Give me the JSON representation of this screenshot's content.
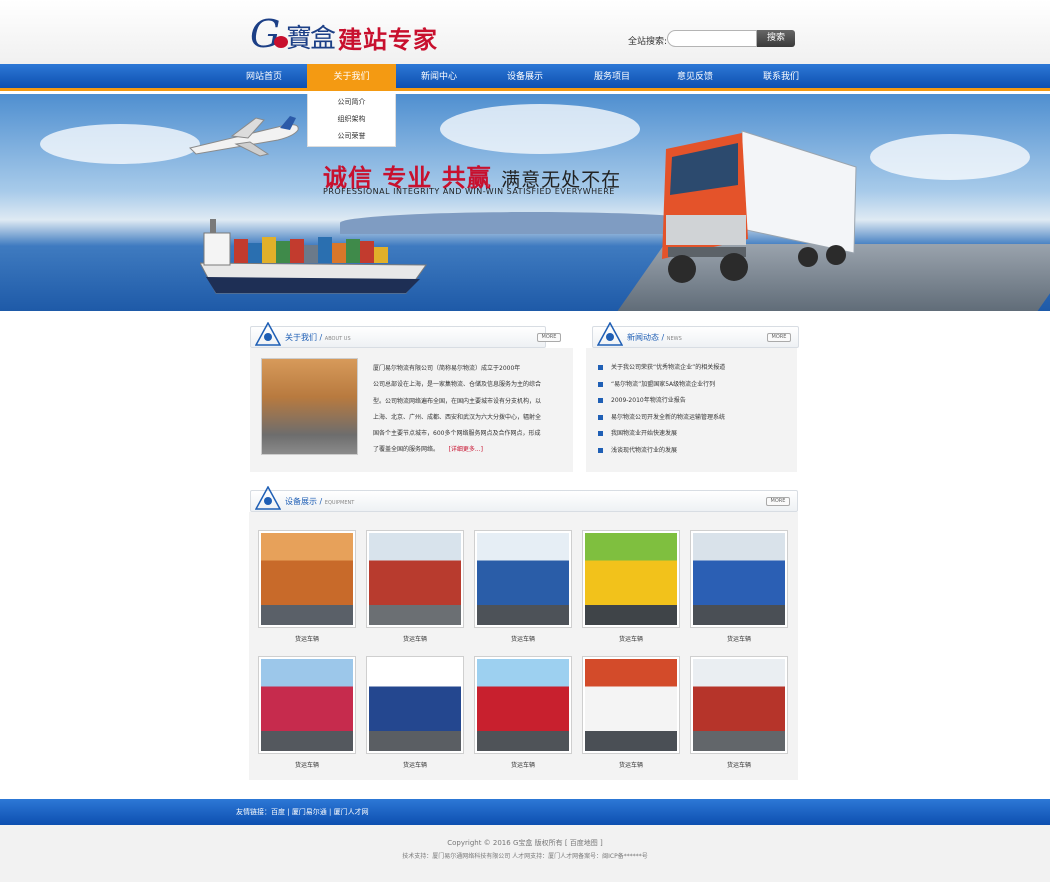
{
  "header": {
    "logo_letter": "G",
    "logo_name": "寶盒",
    "logo_slogan": "建站专家",
    "search_label": "全站搜索:",
    "search_value": "",
    "search_button": "搜索"
  },
  "nav": {
    "items": [
      "网站首页",
      "关于我们",
      "新闻中心",
      "设备展示",
      "服务项目",
      "意见反馈",
      "联系我们"
    ],
    "active_index": 1,
    "dropdown": [
      "公司简介",
      "组织架构",
      "公司荣誉"
    ]
  },
  "banner": {
    "slogan_main": "诚信 专业 共赢",
    "slogan_tail": "满意无处不在",
    "slogan_sub": "PROFESSIONAL INTEGRITY AND WIN-WIN SATISFIED EVERYWHERE"
  },
  "about": {
    "title": "关于我们",
    "subtitle": "ABOUT US",
    "more": "MORE",
    "lines": [
      "厦门易尔物流有限公司（简称易尔物流）成立于2000年",
      "公司总部设在上海，是一家集物流、仓储及信息服务为主的综合",
      "型。公司物流网络遍布全国，在国内主要城市设有分支机构，以",
      "上海、北京、广州、成都、西安和武汉为六大分拨中心，辐射全",
      "国各个主要节点城市，600多个网络服务网点及合作网点，形成",
      "了覆盖全国的服务网络。"
    ],
    "more_link": "[详细更多...]"
  },
  "news": {
    "title": "新闻动态",
    "subtitle": "NEWS",
    "more": "MORE",
    "items": [
      "关于我公司荣获“优秀物流企业”的相关报道",
      "“易尔物流”加盟国家5A级物流企业行列",
      "2009-2010年物流行业报告",
      "易尔物流公司开发全新的物流运输管理系统",
      "我国物流业开始快速发展",
      "浅谈现代物流行业的发展"
    ]
  },
  "equipment": {
    "title": "设备展示",
    "subtitle": "EQUIPMENT",
    "more": "MORE",
    "caption": "货运车辆",
    "items": [
      {
        "colors": [
          "#c86a2a",
          "#e7a15a",
          "#5a6068"
        ]
      },
      {
        "colors": [
          "#b83b2e",
          "#d8e3ec",
          "#6b6f73"
        ]
      },
      {
        "colors": [
          "#2a5da8",
          "#e6eef5",
          "#4d5258"
        ]
      },
      {
        "colors": [
          "#f2c21b",
          "#7fbf3f",
          "#3f4448"
        ]
      },
      {
        "colors": [
          "#2b5fb4",
          "#d9e2ea",
          "#4a4f55"
        ]
      },
      {
        "colors": [
          "#c62b4d",
          "#9cc7ea",
          "#54585e"
        ]
      },
      {
        "colors": [
          "#24478f",
          "#ffffff",
          "#5a5e63"
        ]
      },
      {
        "colors": [
          "#c8202e",
          "#9dd0f0",
          "#4f5358"
        ]
      },
      {
        "colors": [
          "#f4f4f4",
          "#d34b2a",
          "#4a4f55"
        ]
      },
      {
        "colors": [
          "#b6342a",
          "#eaeef2",
          "#62666a"
        ]
      }
    ]
  },
  "footer": {
    "links_label": "友情链接：",
    "links": [
      "百度",
      "厦门易尔通",
      "厦门人才网"
    ],
    "copyright": "Copyright © 2016 G宝盒 版权所有 [ 百度地图 ]",
    "support": "技术支持：厦门易尔通网络科技有限公司 人才网支持：厦门人才网备案号：闽ICP备******号"
  }
}
